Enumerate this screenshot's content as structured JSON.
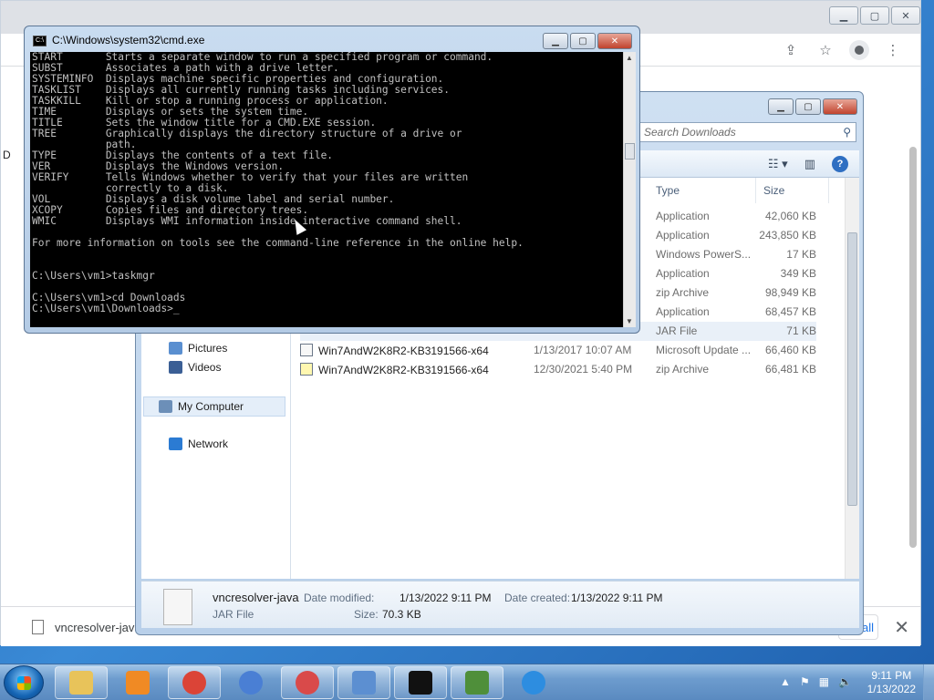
{
  "chrome": {
    "left_text": "D",
    "downloads_bar": {
      "file": "vncresolver-java",
      "show_all": "all",
      "close": "✕"
    }
  },
  "explorer": {
    "search_placeholder": "Search Downloads",
    "columns": {
      "type": "Type",
      "size": "Size"
    },
    "nav": [
      {
        "label": "Pictures",
        "color": "#5a8fd0"
      },
      {
        "label": "Videos",
        "color": "#3b5f95"
      },
      {
        "label": "My Computer",
        "color": "#6c8fb8"
      },
      {
        "label": "Network",
        "color": "#2b7bd3"
      }
    ],
    "rows": [
      {
        "name": "",
        "date": "",
        "type": "Application",
        "size": "42,060 KB"
      },
      {
        "name": "",
        "date": "",
        "type": "Application",
        "size": "243,850 KB"
      },
      {
        "name": "",
        "date": "",
        "type": "Windows PowerS...",
        "size": "17 KB"
      },
      {
        "name": "",
        "date": "",
        "type": "Application",
        "size": "349 KB"
      },
      {
        "name": "",
        "date": "",
        "type": "zip Archive",
        "size": "98,949 KB"
      },
      {
        "name": "",
        "date": "",
        "type": "Application",
        "size": "68,457 KB"
      },
      {
        "name": "",
        "date": "",
        "type": "JAR File",
        "size": "71 KB"
      },
      {
        "name": "Win7AndW2K8R2-KB3191566-x64",
        "date": "1/13/2017 10:07 AM",
        "type": "Microsoft Update ...",
        "size": "66,460 KB"
      },
      {
        "name": "Win7AndW2K8R2-KB3191566-x64",
        "date": "12/30/2021 5:40 PM",
        "type": "zip Archive",
        "size": "66,481 KB"
      }
    ],
    "details": {
      "name": "vncresolver-java",
      "type": "JAR File",
      "modified_label": "Date modified:",
      "modified": "1/13/2022 9:11 PM",
      "created_label": "Date created:",
      "created": "1/13/2022 9:11 PM",
      "size_label": "Size:",
      "size": "70.3 KB"
    }
  },
  "cmd": {
    "title": "C:\\Windows\\system32\\cmd.exe",
    "icon_text": "C:\\",
    "lines": [
      "START       Starts a separate window to run a specified program or command.",
      "SUBST       Associates a path with a drive letter.",
      "SYSTEMINFO  Displays machine specific properties and configuration.",
      "TASKLIST    Displays all currently running tasks including services.",
      "TASKKILL    Kill or stop a running process or application.",
      "TIME        Displays or sets the system time.",
      "TITLE       Sets the window title for a CMD.EXE session.",
      "TREE        Graphically displays the directory structure of a drive or",
      "            path.",
      "TYPE        Displays the contents of a text file.",
      "VER         Displays the Windows version.",
      "VERIFY      Tells Windows whether to verify that your files are written",
      "            correctly to a disk.",
      "VOL         Displays a disk volume label and serial number.",
      "XCOPY       Copies files and directory trees.",
      "WMIC        Displays WMI information inside interactive command shell.",
      "",
      "For more information on tools see the command-line reference in the online help.",
      "",
      "",
      "C:\\Users\\vm1>taskmgr",
      "",
      "C:\\Users\\vm1>cd Downloads",
      ""
    ],
    "prompt": "C:\\Users\\vm1\\Downloads>"
  },
  "taskbar": {
    "apps": [
      {
        "name": "explorer",
        "color": "#e8c35a"
      },
      {
        "name": "media-player",
        "color": "#f08a24"
      },
      {
        "name": "chrome",
        "color": "#db4437"
      },
      {
        "name": "chrome-canary",
        "color": "#4a7fd4"
      },
      {
        "name": "snipping-tool",
        "color": "#d94a4a"
      },
      {
        "name": "control-panel",
        "color": "#5c8fd1"
      },
      {
        "name": "cmd",
        "color": "#111111"
      },
      {
        "name": "network-monitor",
        "color": "#4f8f3a"
      },
      {
        "name": "internet-explorer",
        "color": "#2d8de0"
      }
    ],
    "time": "9:11 PM",
    "date": "1/13/2022"
  }
}
